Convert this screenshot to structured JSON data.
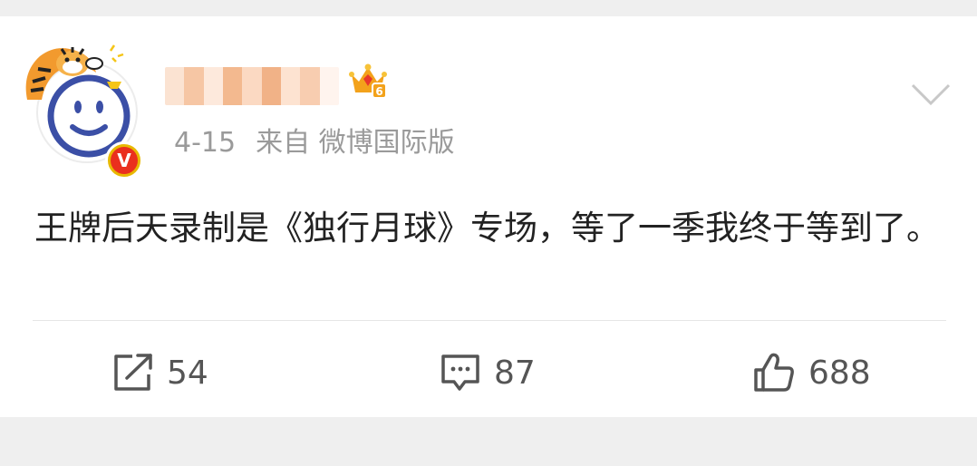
{
  "post": {
    "username": "",
    "vip_level": "6",
    "verified_mark": "V",
    "time": "4-15",
    "source": "来自 微博国际版",
    "content": "王牌后天录制是《独行月球》专场，等了一季我终于等到了。"
  },
  "actions": {
    "repost_count": "54",
    "comment_count": "87",
    "like_count": "688"
  },
  "icons": {
    "repost": "share-arrow-icon",
    "comment": "comment-bubble-icon",
    "like": "thumbs-up-icon",
    "menu": "chevron-down-icon",
    "vip": "crown-icon"
  },
  "colors": {
    "background": "#efefef",
    "card": "#ffffff",
    "text": "#222222",
    "meta": "#9a9a9a",
    "verified_badge": "#ea2f1e",
    "vip_crown": "#f3a21b"
  }
}
